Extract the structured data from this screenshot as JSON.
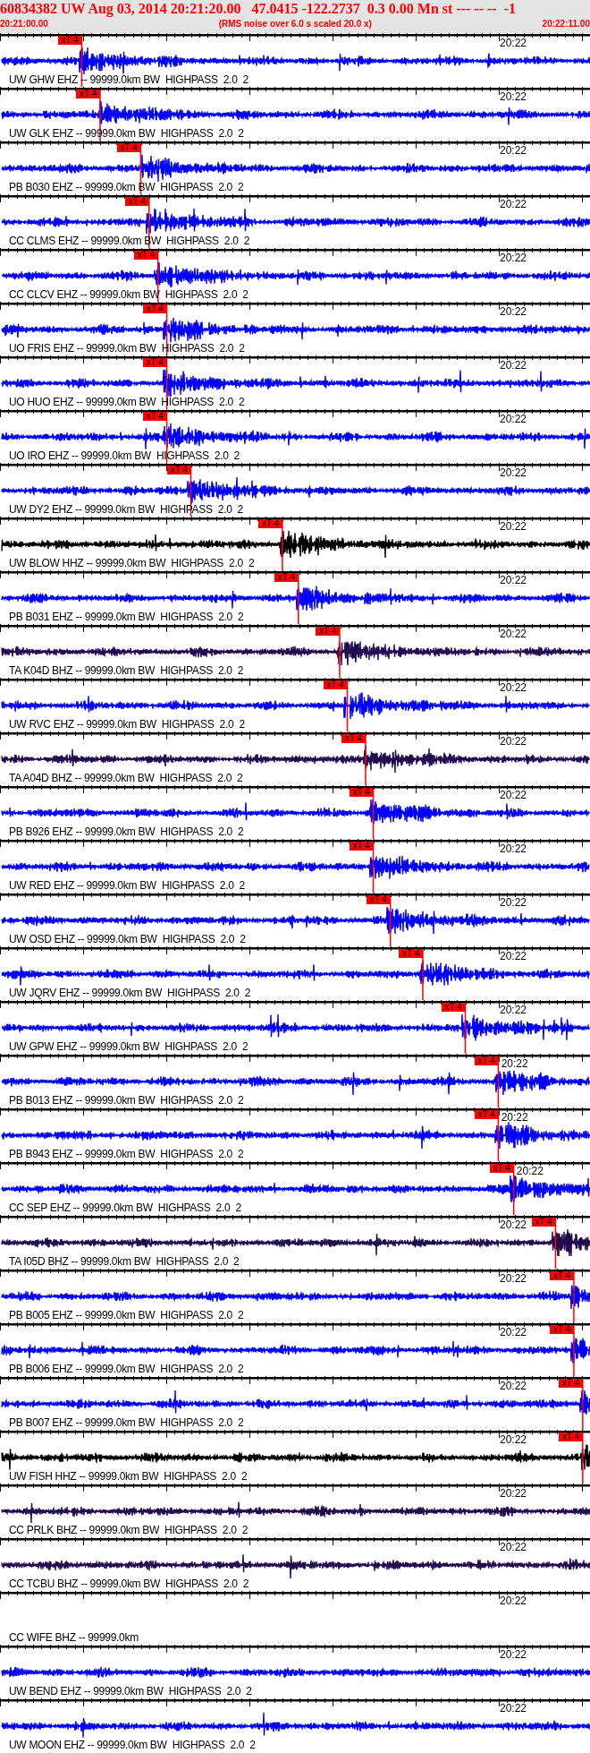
{
  "header": {
    "title": "60834382 UW Aug 03, 2014 20:21:20.00   47.0415 -122.2737  0.3 0.00 Mn st --- -- --  -1",
    "start_time": "20:21:00.00",
    "note": "(RMS noise over 6.0 s scaled 20.0 x)",
    "end_time": "20:22:11.00"
  },
  "traces": [
    {
      "label": "UW GHW EHZ -- 99999.0km BW  HIGHPASS  2.0  2",
      "time_label": "20:22",
      "color": "#0000ff",
      "kind": "trace",
      "pick": {
        "label": "xT 4",
        "level": 0.139
      }
    },
    {
      "label": "UW GLK EHZ -- 99999.0km BW  HIGHPASS  2.0  2",
      "time_label": "20:22",
      "color": "#0000ff",
      "kind": "trace",
      "pick": {
        "label": "xT 4",
        "level": 0.17
      }
    },
    {
      "label": "PB B030 EHZ -- 99999.0km BW  HIGHPASS  2.0  2",
      "time_label": "20:22",
      "color": "#0000ff",
      "kind": "trace",
      "pick": {
        "label": "xT 4",
        "level": 0.239
      }
    },
    {
      "label": "CC CLMS EHZ -- 99999.0km BW  HIGHPASS  2.0  2",
      "time_label": "20:22",
      "color": "#0000ff",
      "kind": "trace",
      "pick": {
        "label": "xT 4",
        "level": 0.253
      }
    },
    {
      "label": "CC CLCV EHZ -- 99999.0km BW  HIGHPASS  2.0  2",
      "time_label": "20:22",
      "color": "#0000ff",
      "kind": "trace",
      "pick": {
        "label": "xT 4",
        "level": 0.268
      }
    },
    {
      "label": "UO FRIS EHZ -- 99999.0km BW  HIGHPASS  2.0  2",
      "time_label": "20:22",
      "color": "#0000ff",
      "kind": "trace",
      "pick": {
        "label": "xT 4",
        "level": 0.283
      }
    },
    {
      "label": "UO HUO EHZ -- 99999.0km BW  HIGHPASS  2.0  2",
      "time_label": "20:22",
      "color": "#0000ff",
      "kind": "trace",
      "pick": {
        "label": "xT 4",
        "level": 0.283
      }
    },
    {
      "label": "UO IRO EHZ -- 99999.0km BW  HIGHPASS  2.0  2",
      "time_label": "20:22",
      "color": "#0000ff",
      "kind": "trace",
      "pick": {
        "label": "xT 4",
        "level": 0.283
      }
    },
    {
      "label": "UW DY2 EHZ -- 99999.0km BW  HIGHPASS  2.0  2",
      "time_label": "20:22",
      "color": "#0000ff",
      "kind": "trace",
      "pick": {
        "label": "xT 4",
        "level": 0.324
      }
    },
    {
      "label": "UW BLOW HHZ -- 99999.0km BW  HIGHPASS  2.0  2",
      "time_label": "20:22",
      "color": "#000000",
      "kind": "trace",
      "pick": {
        "label": "xT 4",
        "level": 0.479
      }
    },
    {
      "label": "PB B031 EHZ -- 99999.0km BW  HIGHPASS  2.0  2",
      "time_label": "20:22",
      "color": "#0000ff",
      "kind": "trace",
      "pick": {
        "label": "xT 4",
        "level": 0.506
      }
    },
    {
      "label": "TA K04D BHZ -- 99999.0km BW  HIGHPASS  2.0  2",
      "time_label": "20:22",
      "color": "#220a50",
      "kind": "trace",
      "pick": {
        "label": "xT 4",
        "level": 0.576
      }
    },
    {
      "label": "UW RVC EHZ -- 99999.0km BW  HIGHPASS  2.0  2",
      "time_label": "20:22",
      "color": "#0000ff",
      "kind": "trace",
      "pick": {
        "label": "xT 4",
        "level": 0.589
      }
    },
    {
      "label": "TA A04D BHZ -- 99999.0km BW  HIGHPASS  2.0  2",
      "time_label": "20:22",
      "color": "#220a50",
      "kind": "trace",
      "pick": {
        "label": "xT 4",
        "level": 0.62
      }
    },
    {
      "label": "PB B926 EHZ -- 99999.0km BW  HIGHPASS  2.0  2",
      "time_label": "20:22",
      "color": "#0000ff",
      "kind": "trace",
      "pick": {
        "label": "xT 4",
        "level": 0.633
      }
    },
    {
      "label": "UW RED EHZ -- 99999.0km BW  HIGHPASS  2.0  2",
      "time_label": "20:22",
      "color": "#0000ff",
      "kind": "trace",
      "pick": {
        "label": "xT 4",
        "level": 0.633
      }
    },
    {
      "label": "UW OSD EHZ -- 99999.0km BW  HIGHPASS  2.0  2",
      "time_label": "20:22",
      "color": "#0000ff",
      "kind": "trace",
      "pick": {
        "label": "xT 4",
        "level": 0.662
      }
    },
    {
      "label": "UW JQRV EHZ -- 99999.0km BW  HIGHPASS  2.0  2",
      "time_label": "20:22",
      "color": "#0000ff",
      "kind": "trace",
      "pick": {
        "label": "xT 4",
        "level": 0.717
      }
    },
    {
      "label": "UW GPW EHZ -- 99999.0km BW  HIGHPASS  2.0  2",
      "time_label": "20:22",
      "color": "#0000ff",
      "kind": "trace",
      "pick": {
        "label": "xT 4",
        "level": 0.789
      }
    },
    {
      "label": "PB B013 EHZ -- 99999.0km BW  HIGHPASS  2.0  2",
      "time_label": "20:22",
      "color": "#0000ff",
      "kind": "trace",
      "pick": {
        "label": "xT 4",
        "level": 0.845
      }
    },
    {
      "label": "PB B943 EHZ -- 99999.0km BW  HIGHPASS  2.0  2",
      "time_label": "20:22",
      "color": "#0000ff",
      "kind": "trace",
      "pick": {
        "label": "xT 4",
        "level": 0.845
      }
    },
    {
      "label": "CC SEP EHZ -- 99999.0km BW  HIGHPASS  2.0  2",
      "time_label": "20:22",
      "color": "#0000ff",
      "kind": "trace",
      "pick": {
        "label": "xT 4",
        "level": 0.871
      }
    },
    {
      "label": "TA I05D BHZ -- 99999.0km BW  HIGHPASS  2.0  2",
      "time_label": "20:22",
      "color": "#220a50",
      "kind": "trace",
      "pick": {
        "label": "xT 4",
        "level": 0.942
      }
    },
    {
      "label": "PB B005 EHZ -- 99999.0km BW  HIGHPASS  2.0  2",
      "time_label": "20:22",
      "color": "#0000ff",
      "kind": "trace",
      "pick": {
        "label": "xT 4",
        "level": 0.973
      }
    },
    {
      "label": "PB B006 EHZ -- 99999.0km BW  HIGHPASS  2.0  2",
      "time_label": "20:22",
      "color": "#0000ff",
      "kind": "trace",
      "pick": {
        "label": "xT 4",
        "level": 0.973
      }
    },
    {
      "label": "PB B007 EHZ -- 99999.0km BW  HIGHPASS  2.0  2",
      "time_label": "20:22",
      "color": "#0000ff",
      "kind": "trace",
      "pick": {
        "label": "xT 4",
        "level": 0.988
      }
    },
    {
      "label": "UW FISH HHZ -- 99999.0km BW  HIGHPASS  2.0  2",
      "time_label": "20:22",
      "color": "#000000",
      "kind": "trace",
      "pick": {
        "label": "xT 4",
        "level": 0.988
      }
    },
    {
      "label": "CC PRLK BHZ -- 99999.0km BW  HIGHPASS  2.0  2",
      "time_label": "20:22",
      "color": "#220a50",
      "kind": "trace"
    },
    {
      "label": "CC TCBU BHZ -- 99999.0km BW  HIGHPASS  2.0  2",
      "time_label": "20:22",
      "color": "#220a50",
      "kind": "trace"
    },
    {
      "label": "CC WIFE BHZ -- 99999.0km",
      "time_label": "20:22",
      "kind": "empty"
    },
    {
      "label": "UW BEND EHZ -- 99999.0km BW  HIGHPASS  2.0  2",
      "time_label": "20:22",
      "color": "#0000ff",
      "kind": "trace"
    },
    {
      "label": "UW MOON EHZ -- 99999.0km BW  HIGHPASS  2.0  2",
      "time_label": "20:22",
      "color": "#0000ff",
      "kind": "trace"
    }
  ]
}
